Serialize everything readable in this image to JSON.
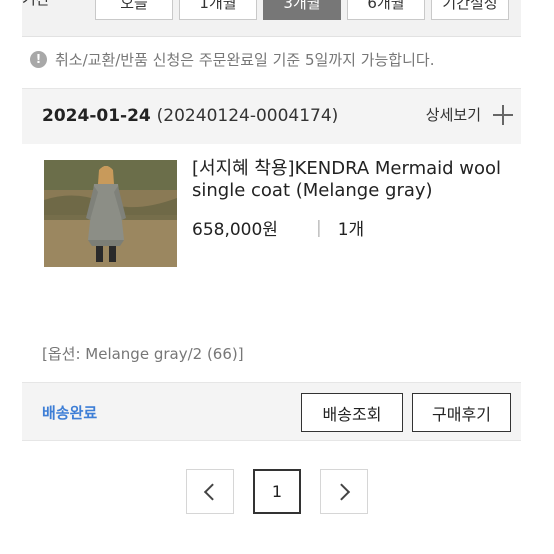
{
  "filter": {
    "label": "기간",
    "periods": [
      "오늘",
      "1개월",
      "3개월",
      "6개월",
      "기간설정"
    ],
    "active_index": 2
  },
  "notice": {
    "icon": "info-icon",
    "text": "취소/교환/반품 신청은 주문완료일 기준 5일까지 가능합니다."
  },
  "order": {
    "date": "2024-01-24",
    "order_number": "(20240124-0004174)",
    "detail_label": "상세보기",
    "product": {
      "name": "[서지혜 착용]KENDRA Mermaid wool single coat (Melange gray)",
      "price": "658,000원",
      "separator": "|",
      "quantity": "1개",
      "option": "[옵션: Melange gray/2 (66)]"
    },
    "status": "배송완료",
    "track_button": "배송조회",
    "review_button": "구매후기"
  },
  "pagination": {
    "pages": [
      "1"
    ],
    "current": "1"
  },
  "colors": {
    "status": "#3d7ed6",
    "active_period_bg": "#777777",
    "header_bg": "#f4f4f4"
  }
}
